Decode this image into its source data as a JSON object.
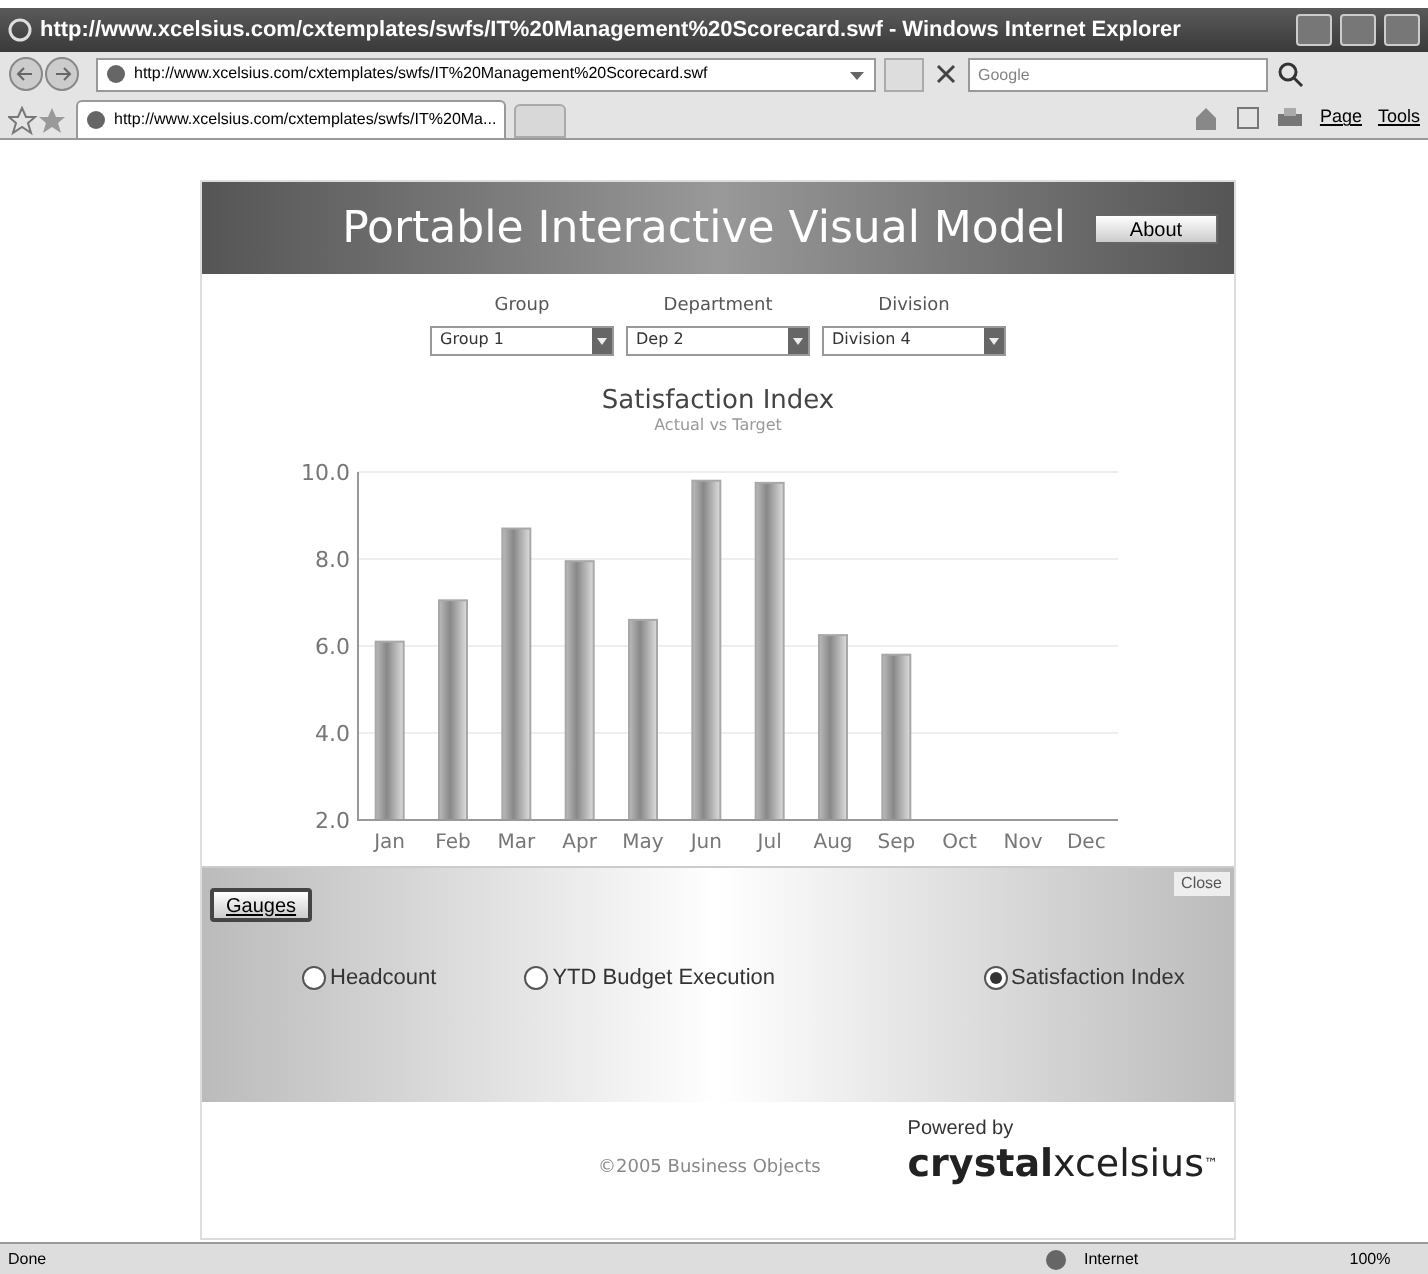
{
  "window": {
    "title": "http://www.xcelsius.com/cxtemplates/swfs/IT%20Management%20Scorecard.swf - Windows Internet Explorer"
  },
  "address_bar": {
    "value": "http://www.xcelsius.com/cxtemplates/swfs/IT%20Management%20Scorecard.swf"
  },
  "search": {
    "placeholder": "Google"
  },
  "tabs": [
    {
      "label": "http://www.xcelsius.com/cxtemplates/swfs/IT%20Ma...",
      "selected": true
    }
  ],
  "command_bar": [
    "Page",
    "Tools"
  ],
  "model": {
    "title": "Portable Interactive Visual Model",
    "about_button": "About",
    "filters": [
      {
        "label": "Group",
        "value": "Group 1"
      },
      {
        "label": "Department",
        "value": "Dep 2"
      },
      {
        "label": "Division",
        "value": "Division 4"
      }
    ],
    "chart": {
      "chart_data": {
        "type": "bar",
        "title": "Satisfaction Index",
        "subtitle": "Actual vs Target",
        "categories": [
          "Jan",
          "Feb",
          "Mar",
          "Apr",
          "May",
          "Jun",
          "Jul",
          "Aug",
          "Sep",
          "Oct",
          "Nov",
          "Dec"
        ],
        "grid": true,
        "series": [
          {
            "color": "#a8a8a8",
            "values": [
              6.1,
              7.05,
              8.7,
              7.95,
              6.6,
              9.8,
              9.75,
              6.25,
              5.8,
              null,
              null,
              null
            ]
          }
        ],
        "ylim": [
          2,
          10
        ],
        "yticks": [
          {
            "value": 2,
            "label": "2.0"
          },
          {
            "value": 4,
            "label": "4.0"
          },
          {
            "value": 6,
            "label": "6.0"
          },
          {
            "value": 8,
            "label": "8.0"
          },
          {
            "value": 10,
            "label": "10.0"
          }
        ]
      }
    },
    "gauges_button": "Gauges",
    "close_button": "Close",
    "options": [
      {
        "label": "Headcount",
        "selected": false
      },
      {
        "label": "YTD Budget Execution",
        "selected": false
      },
      {
        "label": "Satisfaction Index",
        "selected": true
      }
    ],
    "copyright": "©2005 Business Objects",
    "powered_by": "Powered by",
    "logo": {
      "part_1": "crystal",
      "part_2": "xcelsius",
      "mark": "™"
    }
  },
  "status_bar": {
    "status": "Done",
    "zone": "Internet",
    "zoom": "100%"
  }
}
